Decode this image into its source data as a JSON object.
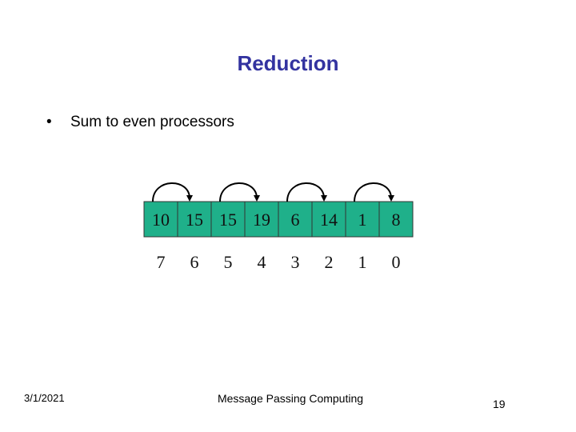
{
  "slide": {
    "title": "Reduction",
    "bullets": [
      {
        "marker": "•",
        "text": "Sum to even processors"
      }
    ]
  },
  "diagram": {
    "cell_values": [
      "10",
      "15",
      "15",
      "19",
      "6",
      "14",
      "1",
      "8"
    ],
    "processor_indices": [
      "7",
      "6",
      "5",
      "4",
      "3",
      "2",
      "1",
      "0"
    ],
    "arrows": [
      {
        "from_cell": 0,
        "to_cell": 1
      },
      {
        "from_cell": 2,
        "to_cell": 3
      },
      {
        "from_cell": 4,
        "to_cell": 5
      },
      {
        "from_cell": 6,
        "to_cell": 7
      }
    ],
    "cell_color": "#1fb08a",
    "border_color": "#333333"
  },
  "footer": {
    "date": "3/1/2021",
    "center": "Message Passing Computing",
    "page": "19"
  }
}
